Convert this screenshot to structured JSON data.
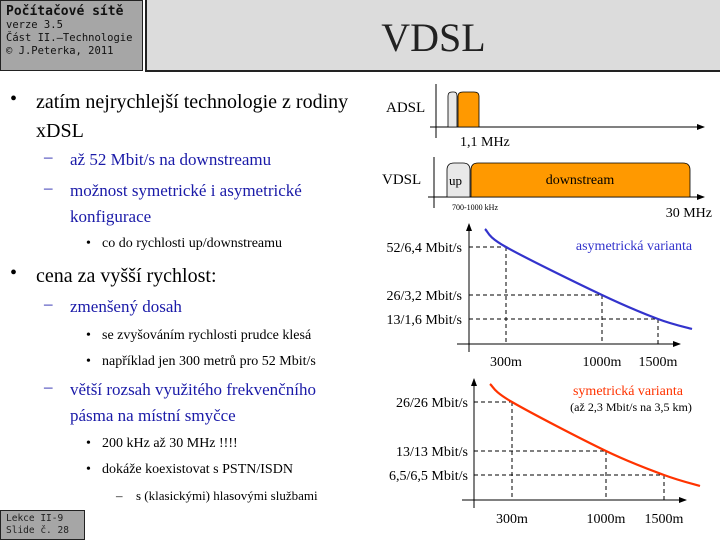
{
  "header": {
    "course": "Počítačové sítě",
    "version": "verze 3.5",
    "part": "Část II.–Technologie",
    "copyright": "© J.Peterka, 2011"
  },
  "title": "VDSL",
  "bullets": [
    {
      "level": 1,
      "mark": "•",
      "text": "zatím nejrychlejší technologie z rodiny xDSL"
    },
    {
      "level": 2,
      "mark": "–",
      "text": "až 52 Mbit/s na downstreamu"
    },
    {
      "level": 2,
      "mark": "–",
      "text": "možnost symetrické i asymetrické konfigurace"
    },
    {
      "level": 3,
      "mark": "•",
      "text": "co do rychlosti  up/downstreamu"
    },
    {
      "level": 1,
      "mark": "•",
      "text": "cena za vyšší rychlost:"
    },
    {
      "level": 2,
      "mark": "–",
      "text": "zmenšený dosah"
    },
    {
      "level": 3,
      "mark": "•",
      "text": "se zvyšováním  rychlosti  prudce klesá"
    },
    {
      "level": 3,
      "mark": "•",
      "text": "například  jen 300 metrů  pro 52 Mbit/s"
    },
    {
      "level": 2,
      "mark": "–",
      "text": "větší rozsah využitého frekvenčního pásma na místní smyčce"
    },
    {
      "level": 3,
      "mark": "•",
      "text": "200 kHz až 30 MHz !!!!"
    },
    {
      "level": 3,
      "mark": "•",
      "text": "dokáže koexistovat  s PSTN/ISDN"
    },
    {
      "level": 4,
      "mark": "–",
      "text": "s (klasickými) hlasovými službami"
    }
  ],
  "footer": {
    "lecture": "Lekce II-9",
    "slide": "Slide č. 28"
  },
  "spectrum": {
    "adsl_label": "ADSL",
    "adsl_freq_label": "1,1 MHz",
    "vdsl_label": "VDSL",
    "up_label": "up",
    "downstream_label": "downstream",
    "split_label": "700-1000 kHz",
    "vdsl_freq_label": "30 MHz",
    "colors": {
      "orange": "#ff9900",
      "grey": "#e8e8e8"
    }
  },
  "chart_data": [
    {
      "type": "line",
      "title": "asymetrická  varianta",
      "color": "#3333cc",
      "x": [
        "300m",
        "1000m",
        "1500m"
      ],
      "xvalues_m": [
        300,
        1000,
        1500
      ],
      "y_labels": [
        "52/6,4 Mbit/s",
        "26/3,2 Mbit/s",
        "13/1,6 Mbit/s"
      ],
      "values_down_mbit": [
        52,
        26,
        13
      ],
      "values_up_mbit": [
        6.4,
        3.2,
        1.6
      ],
      "grid": "dashed guide lines"
    },
    {
      "type": "line",
      "title": "symetrická  varianta",
      "subtitle": "(až 2,3 Mbit/s na 3,5 km)",
      "color": "#ff3300",
      "x": [
        "300m",
        "1000m",
        "1500m"
      ],
      "xvalues_m": [
        300,
        1000,
        1500
      ],
      "y_labels": [
        "26/26 Mbit/s",
        "13/13 Mbit/s",
        "6,5/6,5 Mbit/s"
      ],
      "values_down_mbit": [
        26,
        13,
        6.5
      ],
      "values_up_mbit": [
        26,
        13,
        6.5
      ],
      "grid": "dashed guide lines"
    }
  ]
}
